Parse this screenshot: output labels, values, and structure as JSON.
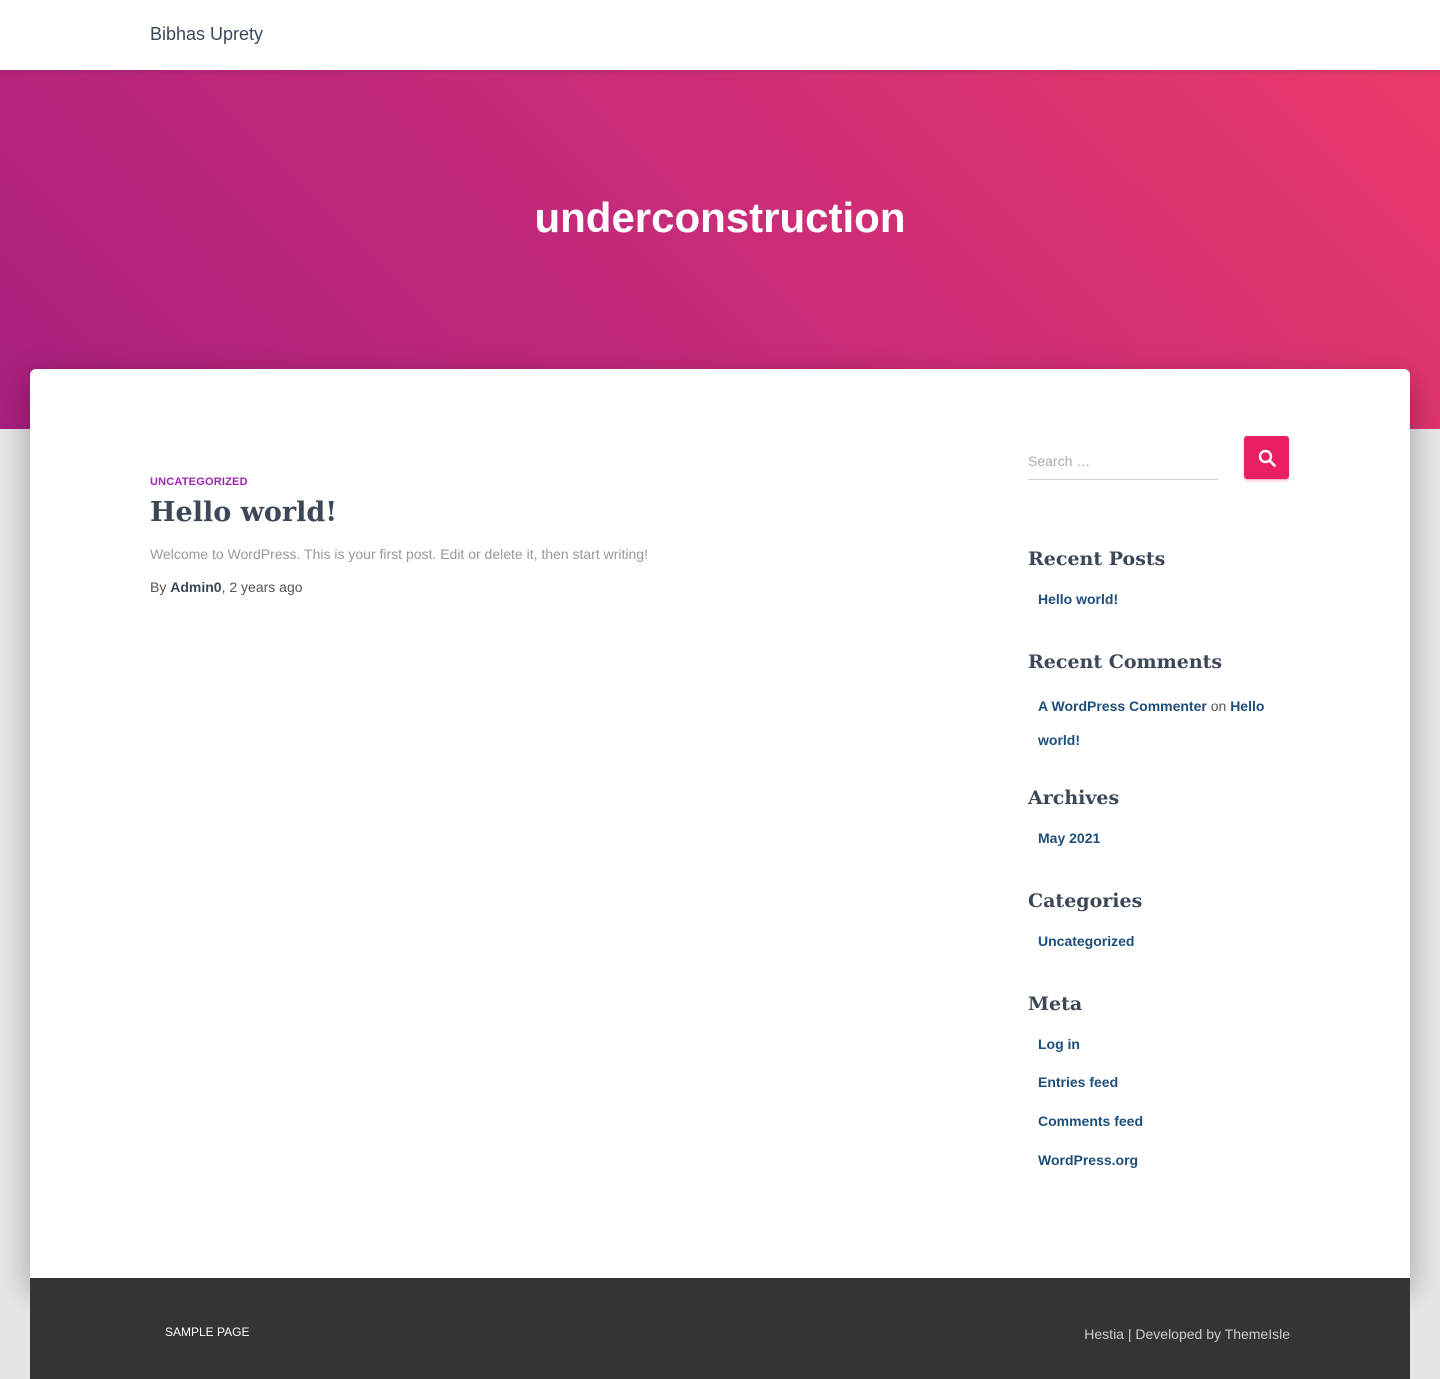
{
  "header": {
    "site_title": "Bibhas Uprety"
  },
  "hero": {
    "title": "underconstruction",
    "gradient": [
      "#a8207f",
      "#ea3a6a"
    ]
  },
  "post": {
    "category": "Uncategorized",
    "title": "Hello world!",
    "excerpt": "Welcome to WordPress. This is your first post. Edit or delete it, then start writing!",
    "by_label": "By",
    "author": "Admin0",
    "separator": ",",
    "time_ago": "2 years ago"
  },
  "sidebar": {
    "search": {
      "placeholder": "Search …",
      "icon": "search-icon"
    },
    "recent_posts": {
      "title": "Recent Posts",
      "items": [
        "Hello world!"
      ]
    },
    "recent_comments": {
      "title": "Recent Comments",
      "commenter": "A WordPress Commenter",
      "on_label": "on",
      "post": "Hello world!"
    },
    "archives": {
      "title": "Archives",
      "items": [
        "May 2021"
      ]
    },
    "categories": {
      "title": "Categories",
      "items": [
        "Uncategorized"
      ]
    },
    "meta": {
      "title": "Meta",
      "items": [
        "Log in",
        "Entries feed",
        "Comments feed",
        "WordPress.org"
      ]
    }
  },
  "footer": {
    "menu": [
      "Sample Page"
    ],
    "credit_prefix": "Hestia | Developed by",
    "credit_link": "ThemeIsle"
  },
  "colors": {
    "accent": "#e91e63",
    "category": "#9c27b0",
    "link": "#1e4f7a",
    "footer_bg": "#323437"
  }
}
